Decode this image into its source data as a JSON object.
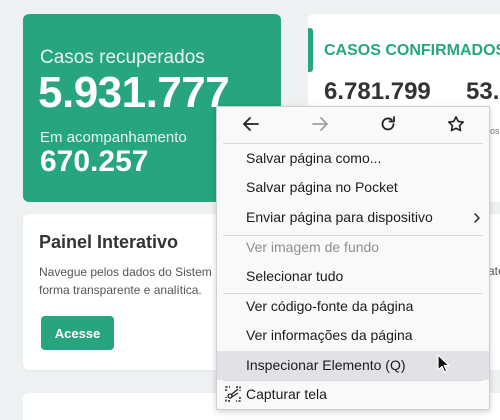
{
  "dashboard": {
    "recovered": {
      "label": "Casos recuperados",
      "value": "5.931.777",
      "sub_label": "Em acompanhamento",
      "sub_value": "670.257"
    },
    "confirmed": {
      "title": "CASOS CONFIRMADOS",
      "value1": "6.781.799",
      "value2": "53.",
      "small_text": "os"
    },
    "painel": {
      "title": "Painel Interativo",
      "desc_line1": "Navegue pelos dados do Sistem",
      "desc_line2": "forma transparente e analítica.",
      "button": "Acesse"
    },
    "right_fragment": "ate"
  },
  "context_menu": {
    "nav": {
      "back_icon": "arrow-left-icon",
      "forward_icon": "arrow-right-icon",
      "reload_icon": "reload-icon",
      "bookmark_icon": "star-icon"
    },
    "items": [
      {
        "label": "Salvar página como..."
      },
      {
        "label": "Salvar página no Pocket"
      },
      {
        "label": "Enviar página para dispositivo"
      },
      {
        "label": "Ver imagem de fundo"
      },
      {
        "label": "Selecionar tudo"
      },
      {
        "label": "Ver código-fonte da página"
      },
      {
        "label": "Ver informações da página"
      },
      {
        "label": "Inspecionar Elemento (Q)"
      },
      {
        "label": "Capturar tela"
      }
    ]
  },
  "colors": {
    "accent": "#27a57f",
    "menu_bg": "#f9f9fa",
    "menu_hover": "#e2e2e6"
  }
}
